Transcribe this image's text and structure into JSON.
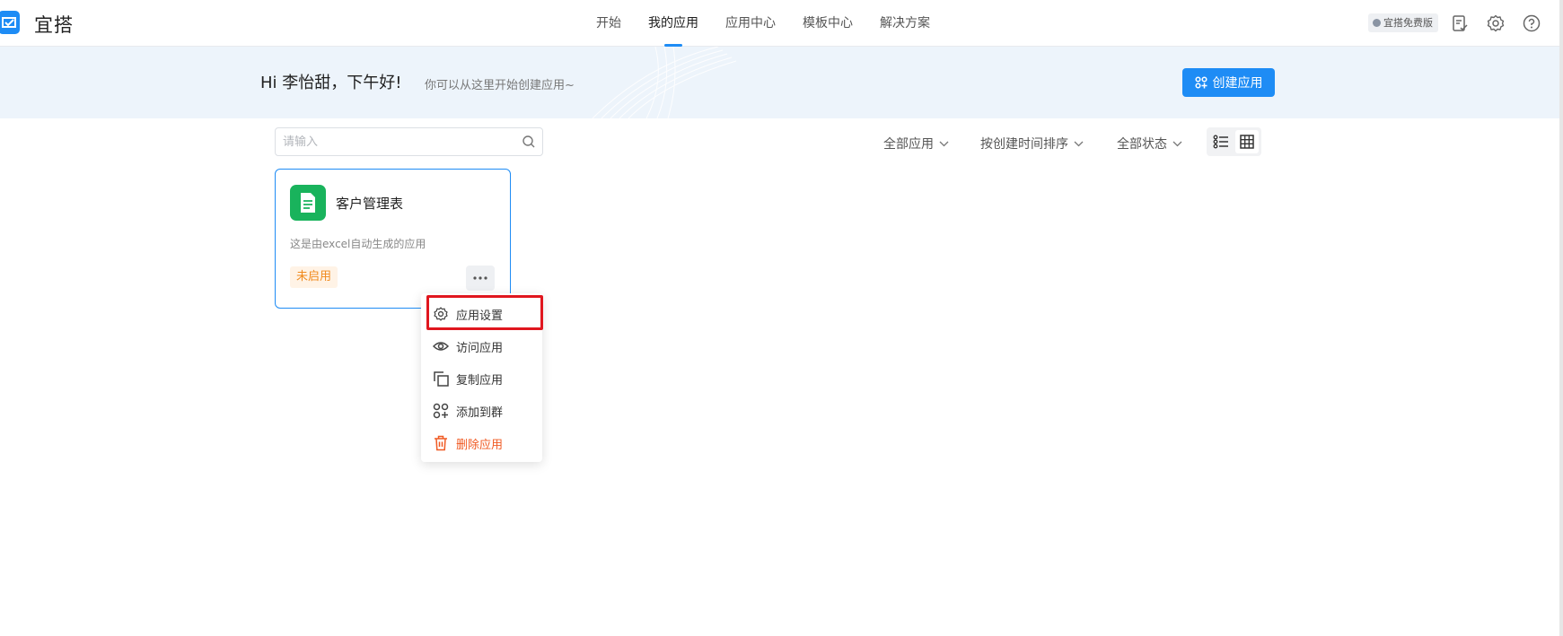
{
  "brand": {
    "name": "宜搭"
  },
  "nav": {
    "items": [
      {
        "label": "开始"
      },
      {
        "label": "我的应用",
        "active": true
      },
      {
        "label": "应用中心"
      },
      {
        "label": "模板中心"
      },
      {
        "label": "解决方案"
      }
    ]
  },
  "header": {
    "plan_badge": "宜搭免费版",
    "icons": [
      "task-icon",
      "gear-icon",
      "help-icon"
    ]
  },
  "banner": {
    "greeting": "Hi 李怡甜，下午好!",
    "subtitle": "你可以从这里开始创建应用~",
    "create_button": "创建应用"
  },
  "toolbar": {
    "search_placeholder": "请输入",
    "filter_apps": "全部应用",
    "sort": "按创建时间排序",
    "filter_status": "全部状态",
    "view_mode": "grid"
  },
  "apps": [
    {
      "name": "客户管理表",
      "description": "这是由excel自动生成的应用",
      "status": "未启用"
    }
  ],
  "menu": {
    "items": [
      {
        "label": "应用设置",
        "icon": "gear-icon",
        "highlighted": true
      },
      {
        "label": "访问应用",
        "icon": "eye-icon"
      },
      {
        "label": "复制应用",
        "icon": "copy-icon"
      },
      {
        "label": "添加到群",
        "icon": "group-add-icon"
      },
      {
        "label": "删除应用",
        "icon": "trash-icon",
        "danger": true
      }
    ]
  },
  "colors": {
    "accent": "#1e8cf5",
    "app_icon": "#19b35c",
    "status_tag": "#f08a1c",
    "danger": "#f05a23",
    "highlight": "#e0161e"
  }
}
